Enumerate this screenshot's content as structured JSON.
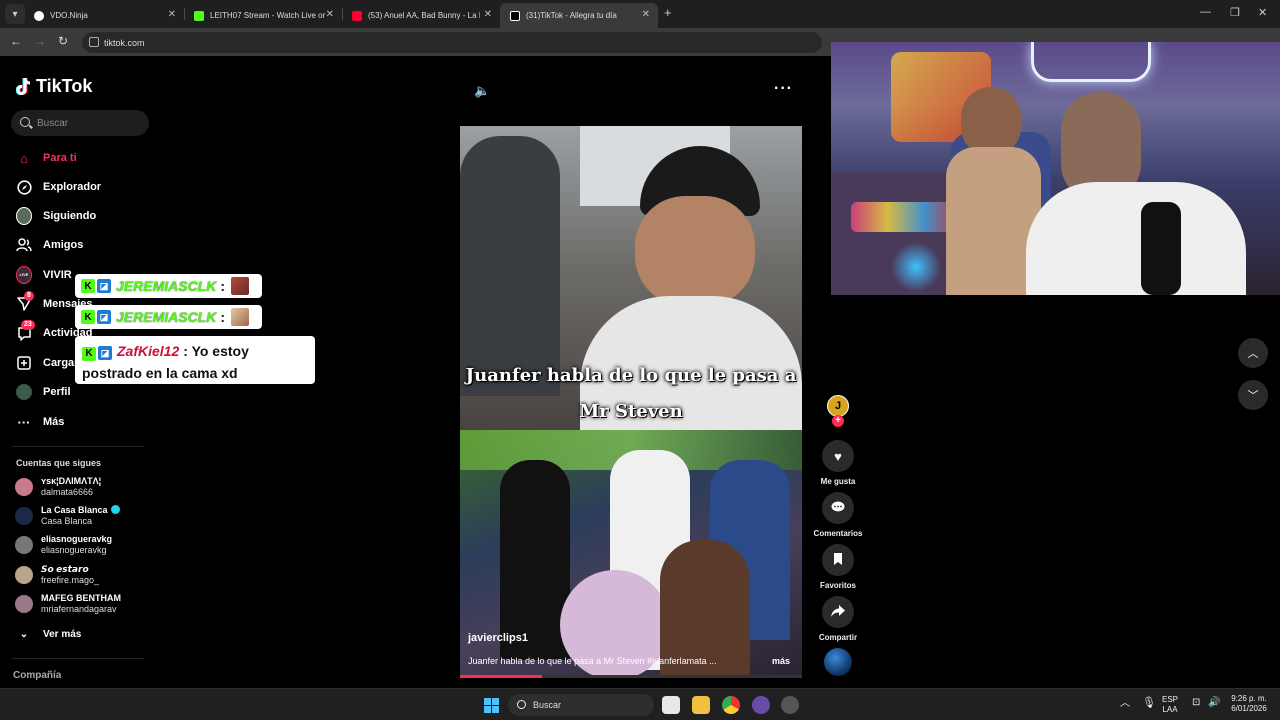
{
  "browser": {
    "tabs": [
      {
        "title": "VDO.Ninja",
        "favicon_color": "#ffffff",
        "active": false
      },
      {
        "title": "LEITH07 Stream - Watch Live or",
        "favicon_color": "#53fc18",
        "active": false
      },
      {
        "title": "(53) Anuel AA, Bad Bunny - La I",
        "favicon_color": "#ff0033",
        "active": false
      },
      {
        "title": "(31)TikTok - Allegra tu día",
        "favicon_color": "#ffffff",
        "active": true
      }
    ],
    "url": "tiktok.com"
  },
  "sidebar": {
    "logo": "TikTok",
    "search_placeholder": "Buscar",
    "nav": [
      {
        "label": "Para ti",
        "icon": "home-icon",
        "active": true
      },
      {
        "label": "Explorador",
        "icon": "compass-icon"
      },
      {
        "label": "Siguiendo",
        "icon": "following-avatar-icon"
      },
      {
        "label": "Amigos",
        "icon": "friends-icon"
      },
      {
        "label": "VIVIR",
        "icon": "live-icon"
      },
      {
        "label": "Mensajes",
        "icon": "messages-icon",
        "badge": "8"
      },
      {
        "label": "Actividad",
        "icon": "activity-icon",
        "badge": "23"
      },
      {
        "label": "Cargar",
        "icon": "upload-icon"
      },
      {
        "label": "Perfil",
        "icon": "profile-icon"
      },
      {
        "label": "Más",
        "icon": "more-icon"
      }
    ],
    "following_title": "Cuentas que sigues",
    "following": [
      {
        "name": "ʏsᴋ¦DΛIMΛTΛ¦",
        "username": "dalmata6666",
        "color": "#c87b8a"
      },
      {
        "name": "La Casa Blanca",
        "username": "Casa Blanca",
        "verified": true,
        "color": "#1c2a4a"
      },
      {
        "name": "eliasnogueravkg",
        "username": "eliasnogueravkg",
        "color": "#777777"
      },
      {
        "name": "𝙎𝙤 𝙚𝙨𝙩𝙖𝙧𝙤",
        "username": "freefire.mago_",
        "color": "#b9a48a"
      },
      {
        "name": "MAFEG BENTHAM",
        "username": "mriafernandagarav",
        "color": "#9a7a8a"
      }
    ],
    "see_more": "Ver más",
    "company": "Compañía"
  },
  "chat": [
    {
      "user": "JEREMIASCLK",
      "sep": ":",
      "message": "",
      "user_color": "#53fc18"
    },
    {
      "user": "JEREMIASCLK",
      "sep": ":",
      "message": "",
      "user_color": "#53fc18"
    },
    {
      "user": "ZafKiel12",
      "sep": ":",
      "message": "Yo estoy postrado en la cama xd",
      "user_color": "#c8103a"
    }
  ],
  "video": {
    "caption_line1": "Juanfer habla de lo que le pasa a",
    "caption_line2": "Mr Steven",
    "username": "javierclips1",
    "description": "Juanfer habla de lo que le pasa a Mr Steven #juanferlamata ...",
    "more": "más",
    "progress": 0.24
  },
  "actions": {
    "avatar_letter": "J",
    "like": "Me gusta",
    "comments": "Comentarios",
    "favorites": "Favoritos",
    "share": "Compartir"
  },
  "taskbar": {
    "search": "Buscar",
    "lang_top": "ESP",
    "lang_bot": "LAA",
    "time": "9:26 p. m.",
    "date": "6/01/2026"
  },
  "colors": {
    "accent": "#fe2c55",
    "kick_green": "#53fc18"
  }
}
